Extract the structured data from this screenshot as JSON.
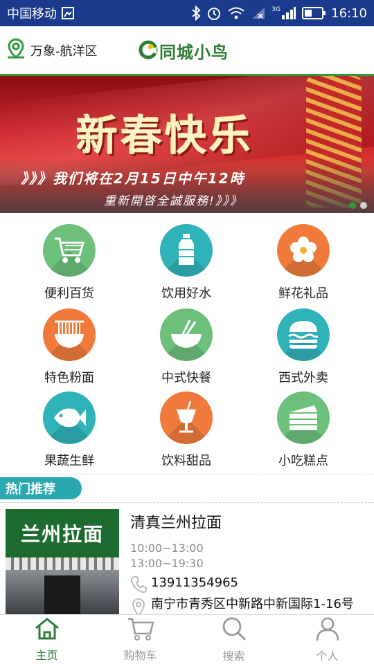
{
  "status_bar": {
    "carrier": "中国移动",
    "network_type": "3G",
    "time": "16:10"
  },
  "header": {
    "location": "万象-航洋区",
    "brand": "同城小鸟",
    "accent_color": "#2e9b3a"
  },
  "banner": {
    "title": "新春快乐",
    "line1": "》》》我们将在2月15日中午12時",
    "line2": "重新開啓全誠服務!》》》",
    "slide_count": 2,
    "active_slide": 1
  },
  "categories": [
    {
      "label": "便利百货",
      "icon": "shopping-cart-icon",
      "color": "#6cc07a"
    },
    {
      "label": "饮用好水",
      "icon": "water-bottle-icon",
      "color": "#2fb3b9"
    },
    {
      "label": "鲜花礼品",
      "icon": "flower-icon",
      "color": "#f07a3c"
    },
    {
      "label": "特色粉面",
      "icon": "noodle-bowl-icon",
      "color": "#f07a3c"
    },
    {
      "label": "中式快餐",
      "icon": "rice-bowl-icon",
      "color": "#6cc07a"
    },
    {
      "label": "西式外卖",
      "icon": "burger-icon",
      "color": "#2fb3b9"
    },
    {
      "label": "果蔬生鲜",
      "icon": "fish-icon",
      "color": "#2fb3b9"
    },
    {
      "label": "饮料甜品",
      "icon": "drink-cup-icon",
      "color": "#f07a3c"
    },
    {
      "label": "小吃糕点",
      "icon": "cake-icon",
      "color": "#6cc07a"
    }
  ],
  "hot": {
    "tag": "热门推荐",
    "tag_color": "#2aa8b0"
  },
  "recommendation": {
    "thumb_sign": "兰州拉面",
    "name": "清真兰州拉面",
    "hours": [
      "10:00~13:00",
      "13:00~19:30"
    ],
    "phone": "13911354965",
    "address": "南宁市青秀区中新路中新国际1-16号"
  },
  "bottom_nav": [
    {
      "label": "主页",
      "icon": "home-icon",
      "active": true
    },
    {
      "label": "购物车",
      "icon": "cart-icon",
      "active": false
    },
    {
      "label": "搜索",
      "icon": "search-icon",
      "active": false
    },
    {
      "label": "个人",
      "icon": "person-icon",
      "active": false
    }
  ]
}
